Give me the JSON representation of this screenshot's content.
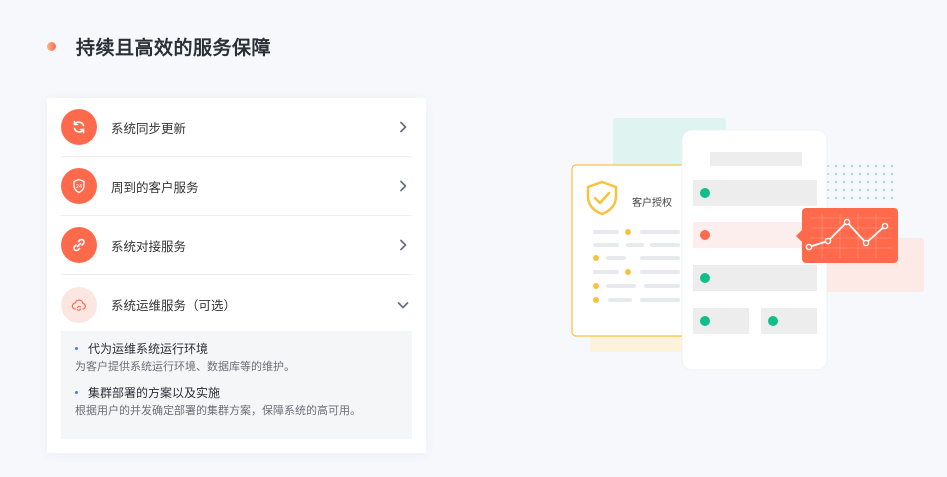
{
  "section": {
    "title": "持续且高效的服务保障"
  },
  "services": {
    "items": [
      {
        "label": "系统同步更新",
        "icon": "sync-icon",
        "expanded": false
      },
      {
        "label": "周到的客户服务",
        "icon": "shield-24-icon",
        "expanded": false
      },
      {
        "label": "系统对接服务",
        "icon": "link-icon",
        "expanded": false
      },
      {
        "label": "系统运维服务（可选）",
        "icon": "cloud-sync-icon",
        "expanded": true
      }
    ],
    "details": [
      {
        "title": "代为运维系统运行环境",
        "text": "为客户提供系统运行环境、数据库等的维护。"
      },
      {
        "title": "集群部署的方案以及实施",
        "text": "根据用户的并发确定部署的集群方案，保障系统的高可用。"
      }
    ]
  },
  "illustration": {
    "auth_label": "客户授权",
    "colors": {
      "accent": "#ff6a4d",
      "green": "#0fbf8b",
      "yellow": "#f9c23c",
      "mint": "#dff3f1"
    }
  }
}
